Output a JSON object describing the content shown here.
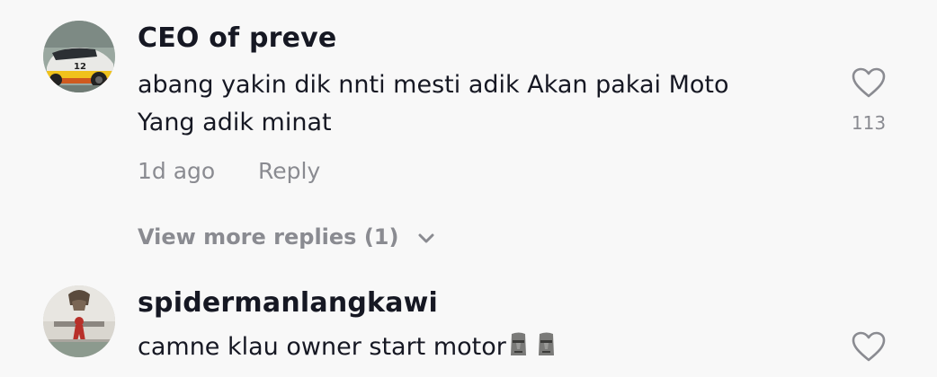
{
  "comments": [
    {
      "username": "CEO of preve",
      "text_line1": "abang yakin dik nnti mesti adik Akan pakai Moto",
      "text_line2": "Yang adik minat",
      "time": "1d ago",
      "reply_label": "Reply",
      "like_count": "113"
    },
    {
      "username": "spidermanlangkawi",
      "text_line1": "camne klau owner start motor",
      "emoji": [
        "moai-emoji",
        "moai-emoji"
      ]
    }
  ],
  "view_more_replies": "View more replies (1)",
  "colors": {
    "background": "#f8f8f8",
    "primary_text": "#161823",
    "secondary_text": "#8a8b91",
    "icon": "#8a8b91"
  }
}
